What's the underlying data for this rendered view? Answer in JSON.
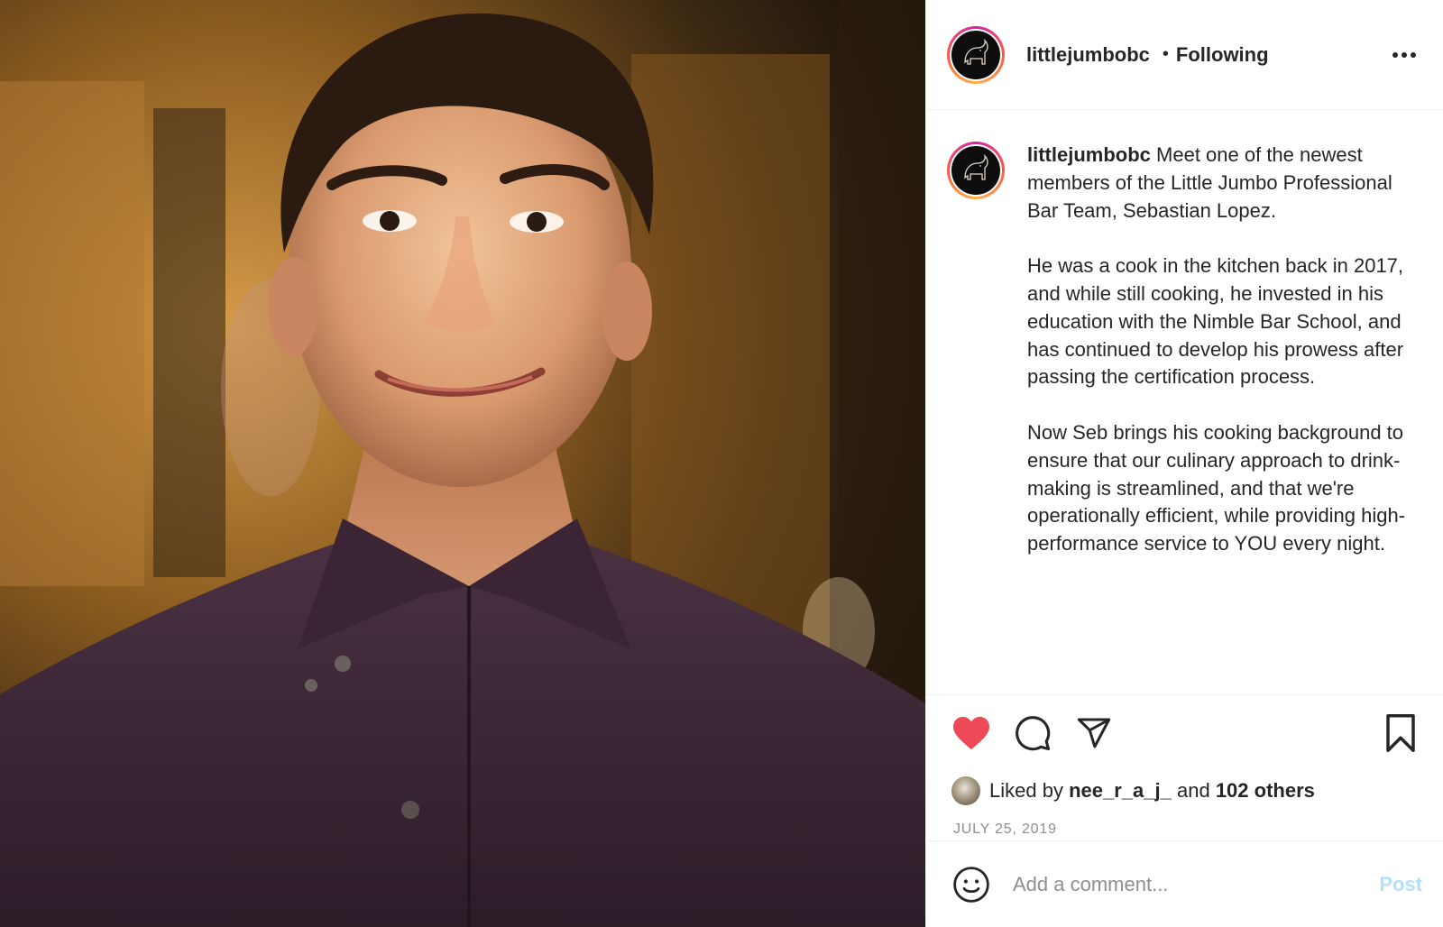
{
  "post": {
    "photo": {
      "subject": "photo",
      "accent_shirt": "#3f2a3a",
      "accent_background": "#9a6a28"
    },
    "header": {
      "username": "littlejumbobc",
      "separator": "•",
      "follow_status": "Following",
      "more_icon": "more-horizontal-icon"
    },
    "caption": {
      "username": "littlejumbobc",
      "paragraphs": [
        "Meet one of the newest members of the Little Jumbo Professional Bar Team, Sebastian Lopez.",
        "He was a cook in the kitchen back in 2017, and while still cooking, he invested in his education with the Nimble Bar School, and has continued to develop his prowess after passing the certification process.",
        "Now Seb brings his cooking background to ensure that our culinary approach to drink-making is streamlined, and that we're operationally efficient, while providing high-performance service to YOU every night."
      ]
    },
    "actions": {
      "like_icon": "heart-filled-icon",
      "like_color": "#ed4956",
      "comment_icon": "comment-icon",
      "share_icon": "paper-plane-icon",
      "save_icon": "bookmark-icon"
    },
    "likes": {
      "prefix": "Liked by",
      "user": "nee_r_a_j_",
      "connector": "and",
      "others": "102 others"
    },
    "date": "JULY 25, 2019",
    "comment": {
      "emoji_icon": "smiley-icon",
      "placeholder": "Add a comment...",
      "post_label": "Post",
      "post_color_disabled": "#b2dffc"
    }
  }
}
